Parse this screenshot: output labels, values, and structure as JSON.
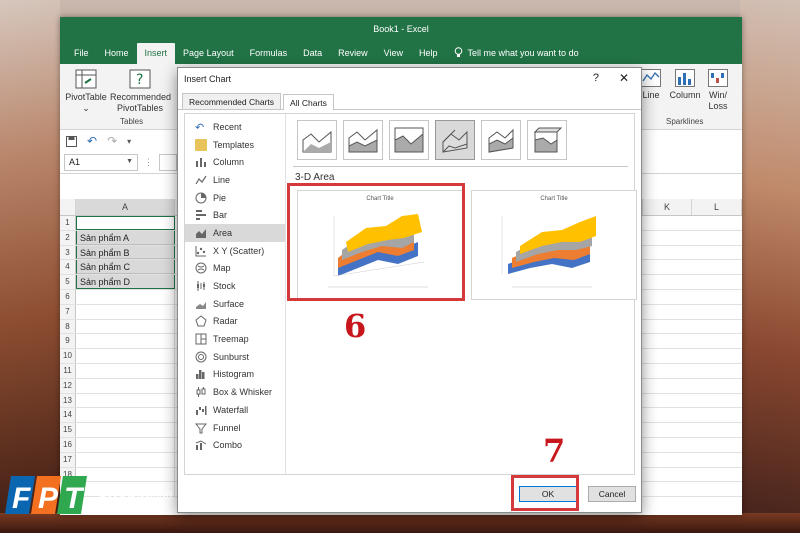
{
  "window": {
    "title": "Book1 - Excel"
  },
  "ribbon_tabs": [
    "File",
    "Home",
    "Insert",
    "Page Layout",
    "Formulas",
    "Data",
    "Review",
    "View",
    "Help"
  ],
  "tell_me": "Tell me what you want to do",
  "ribbon": {
    "pivottable": "PivotTable",
    "recommended_pivot_1": "Recommended",
    "recommended_pivot_2": "PivotTables",
    "tables_group": "Tables",
    "line": "Line",
    "column": "Column",
    "winloss_1": "Win/",
    "winloss_2": "Loss",
    "sparklines_group": "Sparklines"
  },
  "namebox": "A1",
  "columns": [
    "A",
    "K",
    "L"
  ],
  "rows": [
    {
      "num": "1",
      "a": ""
    },
    {
      "num": "2",
      "a": "Sản phẩm A"
    },
    {
      "num": "3",
      "a": "Sản phẩm B"
    },
    {
      "num": "4",
      "a": "Sản phẩm C"
    },
    {
      "num": "5",
      "a": "Sản phẩm D"
    },
    {
      "num": "6",
      "a": ""
    },
    {
      "num": "7",
      "a": ""
    },
    {
      "num": "8",
      "a": ""
    },
    {
      "num": "9",
      "a": ""
    },
    {
      "num": "10",
      "a": ""
    },
    {
      "num": "11",
      "a": ""
    },
    {
      "num": "12",
      "a": ""
    },
    {
      "num": "13",
      "a": ""
    },
    {
      "num": "14",
      "a": ""
    },
    {
      "num": "15",
      "a": ""
    },
    {
      "num": "16",
      "a": ""
    },
    {
      "num": "17",
      "a": ""
    },
    {
      "num": "18",
      "a": ""
    },
    {
      "num": "19",
      "a": ""
    }
  ],
  "dialog": {
    "title": "Insert Chart",
    "help": "?",
    "close": "✕",
    "tab_recommended": "Recommended Charts",
    "tab_all": "All Charts",
    "chart_types": [
      "Recent",
      "Templates",
      "Column",
      "Line",
      "Pie",
      "Bar",
      "Area",
      "X Y (Scatter)",
      "Map",
      "Stock",
      "Surface",
      "Radar",
      "Treemap",
      "Sunburst",
      "Histogram",
      "Box & Whisker",
      "Waterfall",
      "Funnel",
      "Combo"
    ],
    "selected_type": "Area",
    "subtype_heading": "3-D Area",
    "preview_title": "Chart Title",
    "ok": "OK",
    "cancel": "Cancel"
  },
  "annotations": {
    "step6": "6",
    "step7": "7"
  },
  "logo": {
    "brand": "FPT",
    "shop": "Shop",
    "domain": ".com.vn"
  }
}
